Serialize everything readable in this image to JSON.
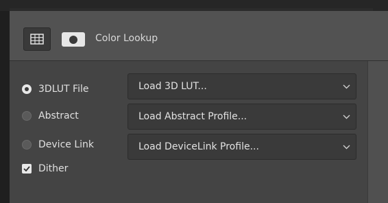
{
  "panel": {
    "title": "Color Lookup",
    "icons": [
      "grid-icon",
      "mask-icon"
    ]
  },
  "options": [
    {
      "label": "3DLUT File",
      "selected": true,
      "dropdown": "Load 3D LUT..."
    },
    {
      "label": "Abstract",
      "selected": false,
      "dropdown": "Load Abstract Profile..."
    },
    {
      "label": "Device Link",
      "selected": false,
      "dropdown": "Load DeviceLink Profile..."
    }
  ],
  "dither": {
    "label": "Dither",
    "checked": true
  },
  "colors": {
    "panel_bg": "#4a4a4a",
    "header_bg": "#525252",
    "dropdown_bg": "#3a3a3a",
    "text": "#e0e0e0"
  }
}
